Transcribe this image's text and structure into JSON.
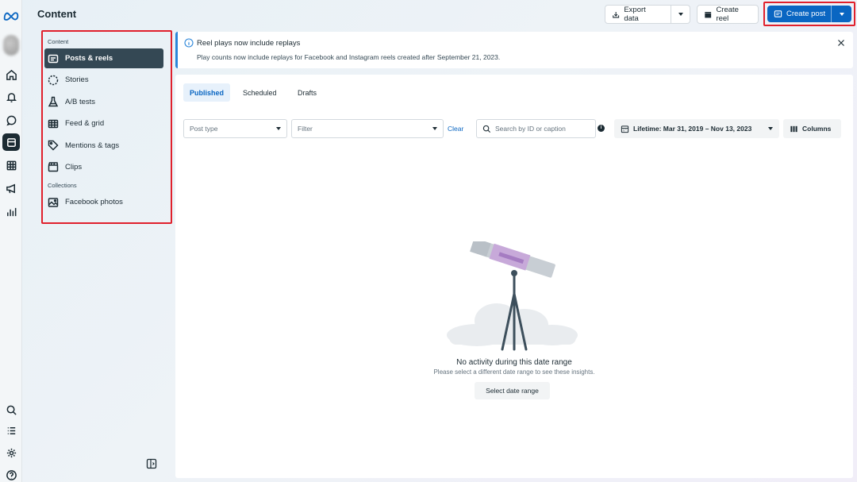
{
  "header": {
    "title": "Content",
    "export_label": "Export data",
    "create_reel_label": "Create reel",
    "create_post_label": "Create post"
  },
  "sidebar": {
    "section_content": "Content",
    "items": [
      {
        "label": "Posts & reels",
        "icon": "posts-icon",
        "active": true
      },
      {
        "label": "Stories",
        "icon": "stories-icon"
      },
      {
        "label": "A/B tests",
        "icon": "flask-icon"
      },
      {
        "label": "Feed & grid",
        "icon": "grid-icon"
      },
      {
        "label": "Mentions & tags",
        "icon": "tag-icon"
      },
      {
        "label": "Clips",
        "icon": "clapper-icon"
      }
    ],
    "section_collections": "Collections",
    "collections": [
      {
        "label": "Facebook photos",
        "icon": "photo-icon"
      }
    ]
  },
  "banner": {
    "title": "Reel plays now include replays",
    "text": "Play counts now include replays for Facebook and Instagram reels created after September 21, 2023."
  },
  "tabs": [
    {
      "label": "Published",
      "active": true
    },
    {
      "label": "Scheduled"
    },
    {
      "label": "Drafts"
    }
  ],
  "filters": {
    "post_type_placeholder": "Post type",
    "filter_placeholder": "Filter",
    "clear_label": "Clear",
    "search_placeholder": "Search by ID or caption",
    "date_range_label": "Lifetime: Mar 31, 2019 – Nov 13, 2023",
    "columns_label": "Columns"
  },
  "empty_state": {
    "title": "No activity during this date range",
    "subtitle": "Please select a different date range to see these insights.",
    "button_label": "Select date range"
  },
  "colors": {
    "accent": "#0a66c2",
    "highlight_border": "#e0202c",
    "active_nav": "#344854"
  }
}
